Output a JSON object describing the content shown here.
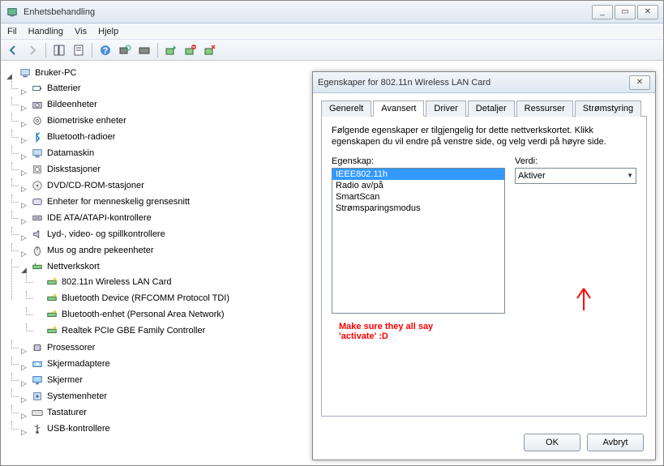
{
  "main_window": {
    "title": "Enhetsbehandling",
    "menus": [
      "Fil",
      "Handling",
      "Vis",
      "Hjelp"
    ],
    "win_controls": {
      "min": "_",
      "max": "▭",
      "close": "✕"
    }
  },
  "tree": {
    "root": "Bruker-PC",
    "nodes": [
      {
        "label": "Batterier",
        "icon": "battery"
      },
      {
        "label": "Bildeenheter",
        "icon": "camera"
      },
      {
        "label": "Biometriske enheter",
        "icon": "fingerprint"
      },
      {
        "label": "Bluetooth-radioer",
        "icon": "bluetooth",
        "expandable": true
      },
      {
        "label": "Datamaskin",
        "icon": "computer"
      },
      {
        "label": "Diskstasjoner",
        "icon": "disk"
      },
      {
        "label": "DVD/CD-ROM-stasjoner",
        "icon": "cd"
      },
      {
        "label": "Enheter for menneskelig grensesnitt",
        "icon": "hid"
      },
      {
        "label": "IDE ATA/ATAPI-kontrollere",
        "icon": "ide"
      },
      {
        "label": "Lyd-, video- og spillkontrollere",
        "icon": "sound"
      },
      {
        "label": "Mus og andre pekeenheter",
        "icon": "mouse"
      },
      {
        "label": "Nettverkskort",
        "icon": "net",
        "expanded": true,
        "children": [
          {
            "label": "802.11n Wireless LAN Card",
            "icon": "netcard"
          },
          {
            "label": "Bluetooth Device (RFCOMM Protocol TDI)",
            "icon": "netcard"
          },
          {
            "label": "Bluetooth-enhet (Personal Area Network)",
            "icon": "netcard"
          },
          {
            "label": "Realtek PCIe GBE Family Controller",
            "icon": "netcard"
          }
        ]
      },
      {
        "label": "Prosessorer",
        "icon": "cpu"
      },
      {
        "label": "Skjermadaptere",
        "icon": "gpu"
      },
      {
        "label": "Skjermer",
        "icon": "monitor"
      },
      {
        "label": "Systemenheter",
        "icon": "system"
      },
      {
        "label": "Tastaturer",
        "icon": "keyboard"
      },
      {
        "label": "USB-kontrollere",
        "icon": "usb"
      }
    ]
  },
  "dialog": {
    "title": "Egenskaper for 802.11n Wireless LAN Card",
    "close": "✕",
    "tabs": [
      "Generelt",
      "Avansert",
      "Driver",
      "Detaljer",
      "Ressurser",
      "Strømstyring"
    ],
    "active_tab": "Avansert",
    "instruction": "Følgende egenskaper er tilgjengelig for dette nettverkskortet. Klikk egenskapen du vil endre på venstre side, og velg verdi på høyre side.",
    "property_label": "Egenskap:",
    "value_label": "Verdi:",
    "properties": [
      "IEEE802.11h",
      "Radio av/på",
      "SmartScan",
      "Strømsparingsmodus"
    ],
    "selected_property": "IEEE802.11h",
    "value": "Aktiver",
    "ok": "OK",
    "cancel": "Avbryt"
  },
  "annotation": {
    "line1": "Make sure they all say",
    "line2": "'activate' :D"
  }
}
